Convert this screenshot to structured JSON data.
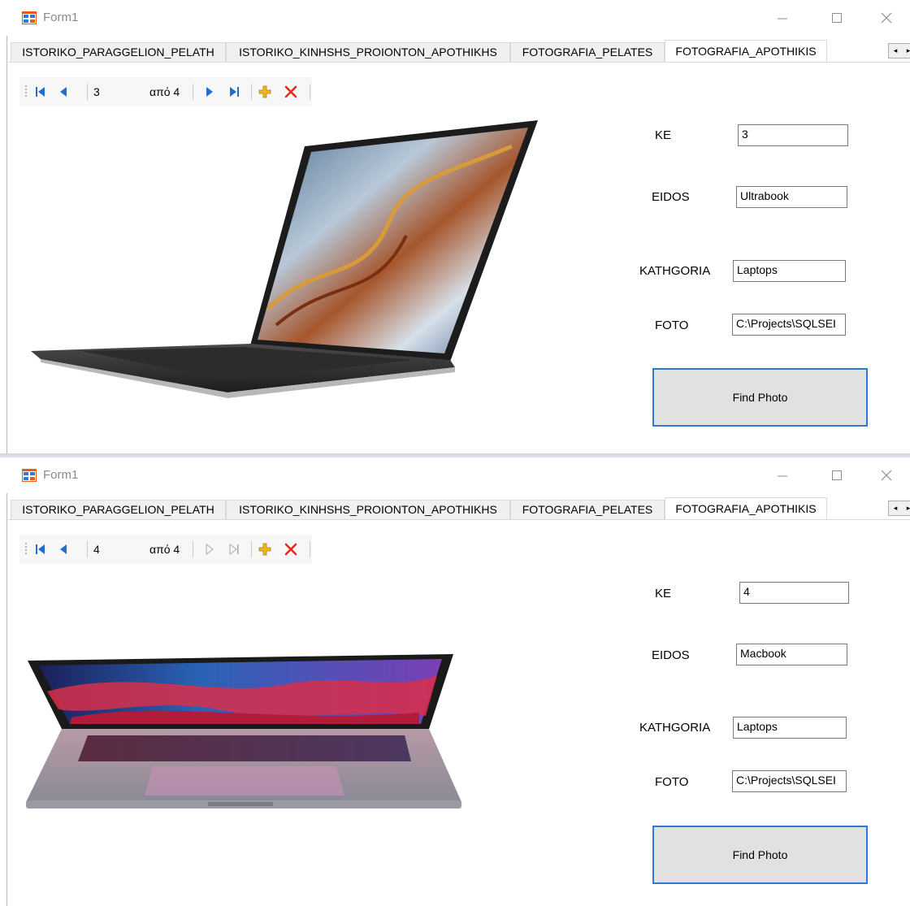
{
  "windows": [
    {
      "title": "Form1",
      "tabs": [
        "ISTORIKO_PARAGGELION_PELATH",
        "ISTORIKO_KINHSHS_PROIONTON_APOTHIKHS",
        "FOTOGRAFIA_PELATES",
        "FOTOGRAFIA_APOTHIKIS"
      ],
      "active_tab": "FOTOGRAFIA_APOTHIKIS",
      "navigator": {
        "position": "3",
        "count_label": "από 4"
      },
      "labels": {
        "ke": "KE",
        "eidos": "EIDOS",
        "kathgoria": "KATHGORIA",
        "foto": "FOTO"
      },
      "fields": {
        "ke": "3",
        "eidos": "Ultrabook",
        "kathgoria": "Laptops",
        "foto": "C:\\Projects\\SQLSEI"
      },
      "find_button": "Find Photo"
    },
    {
      "title": "Form1",
      "tabs": [
        "ISTORIKO_PARAGGELION_PELATH",
        "ISTORIKO_KINHSHS_PROIONTON_APOTHIKHS",
        "FOTOGRAFIA_PELATES",
        "FOTOGRAFIA_APOTHIKIS"
      ],
      "active_tab": "FOTOGRAFIA_APOTHIKIS",
      "navigator": {
        "position": "4",
        "count_label": "από 4"
      },
      "labels": {
        "ke": "KE",
        "eidos": "EIDOS",
        "kathgoria": "KATHGORIA",
        "foto": "FOTO"
      },
      "fields": {
        "ke": "4",
        "eidos": "Macbook",
        "kathgoria": "Laptops",
        "foto": "C:\\Projects\\SQLSEI"
      },
      "find_button": "Find Photo"
    }
  ],
  "colors": {
    "focus_border": "#2f79d0",
    "delete_red": "#e8281e",
    "nav_blue": "#1f6fd1",
    "add_yellow": "#f2b71c"
  }
}
